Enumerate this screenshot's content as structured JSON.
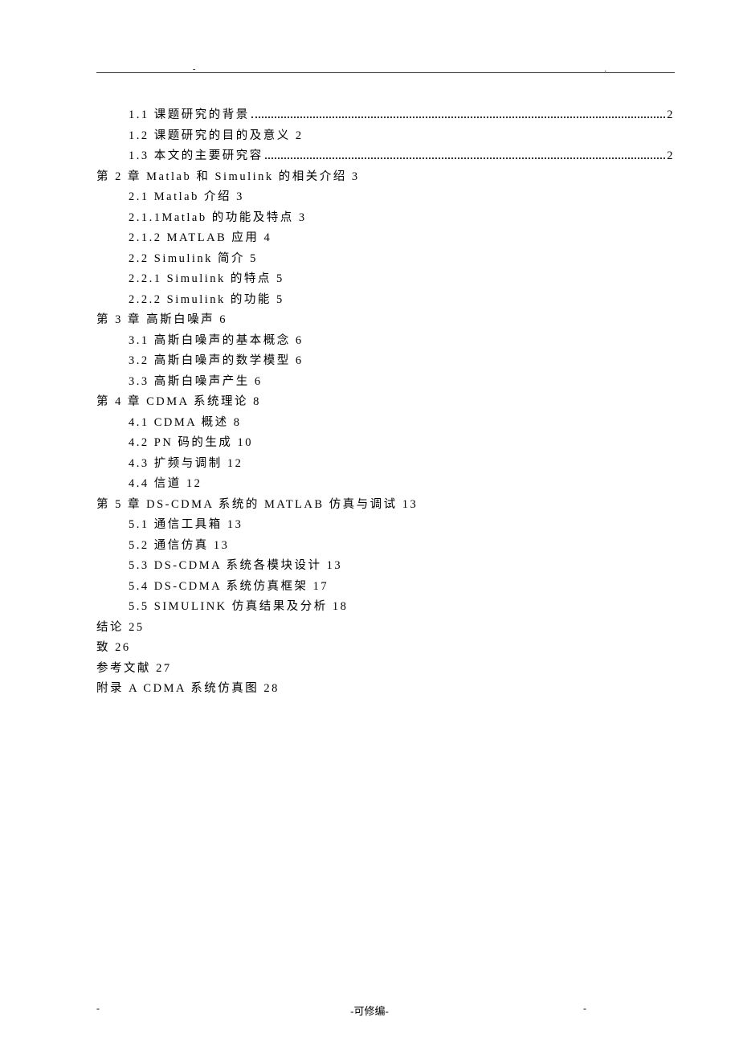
{
  "header": {
    "dash_left": "-",
    "dot_right": "."
  },
  "toc": [
    {
      "indent": "indent1",
      "label": "1.1 课题研究的背景 ",
      "pagenum": "2",
      "dotted": true
    },
    {
      "indent": "indent1",
      "label": "1.2 课题研究的目的及意义 2",
      "dotted": false
    },
    {
      "indent": "indent1",
      "label": "1.3 本文的主要研究容 ",
      "pagenum": "2",
      "dotted": true
    },
    {
      "indent": "indent0",
      "label": "第 2 章 Matlab 和 Simulink 的相关介绍 3",
      "dotted": false
    },
    {
      "indent": "indent2",
      "label": "2.1 Matlab 介绍 3",
      "dotted": false
    },
    {
      "indent": "indent2",
      "label": "2.1.1Matlab 的功能及特点 3",
      "dotted": false
    },
    {
      "indent": "indent2",
      "label": "2.1.2 MATLAB 应用 4",
      "dotted": false
    },
    {
      "indent": "indent2",
      "label": "2.2 Simulink 简介 5",
      "dotted": false
    },
    {
      "indent": "indent2",
      "label": "2.2.1 Simulink 的特点  5",
      "dotted": false
    },
    {
      "indent": "indent2",
      "label": "2.2.2 Simulink 的功能 5",
      "dotted": false
    },
    {
      "indent": "indent0",
      "label": "第 3 章 高斯白噪声 6",
      "dotted": false
    },
    {
      "indent": "indent2",
      "label": "3.1 高斯白噪声的基本概念 6",
      "dotted": false
    },
    {
      "indent": "indent2",
      "label": "3.2 高斯白噪声的数学模型 6",
      "dotted": false
    },
    {
      "indent": "indent2",
      "label": "3.3 高斯白噪声产生                           6",
      "dotted": false
    },
    {
      "indent": "indent0",
      "label": "第 4 章 CDMA 系统理论 8",
      "dotted": false
    },
    {
      "indent": "indent2",
      "label": "4.1 CDMA 概述 8",
      "dotted": false
    },
    {
      "indent": "indent2",
      "label": "4.2 PN 码的生成 10",
      "dotted": false
    },
    {
      "indent": "indent2",
      "label": "4.3 扩频与调制 12",
      "dotted": false
    },
    {
      "indent": "indent2",
      "label": "4.4 信道 12",
      "dotted": false
    },
    {
      "indent": "indent0",
      "label": "第 5 章 DS-CDMA 系统的 MATLAB 仿真与调试 13",
      "dotted": false
    },
    {
      "indent": "indent2",
      "label": "5.1 通信工具箱 13",
      "dotted": false
    },
    {
      "indent": "indent2",
      "label": "5.2 通信仿真 13",
      "dotted": false
    },
    {
      "indent": "indent2",
      "label": "5.3 DS-CDMA 系统各模块设计 13",
      "dotted": false
    },
    {
      "indent": "indent2",
      "label": "5.4 DS-CDMA 系统仿真框架 17",
      "dotted": false
    },
    {
      "indent": "indent2",
      "label": "5.5 SIMULINK 仿真结果及分析 18",
      "dotted": false
    },
    {
      "indent": "indent0",
      "label": "结论 25",
      "dotted": false
    },
    {
      "indent": "indent0",
      "label": "致 26",
      "dotted": false
    },
    {
      "indent": "indent0",
      "label": "参考文献 27",
      "dotted": false
    },
    {
      "indent": "indent0",
      "label": "附录 A CDMA 系统仿真图 28",
      "dotted": false
    }
  ],
  "footer": {
    "text": "-可修编-",
    "dash_left": "-",
    "dash_right": "-"
  }
}
